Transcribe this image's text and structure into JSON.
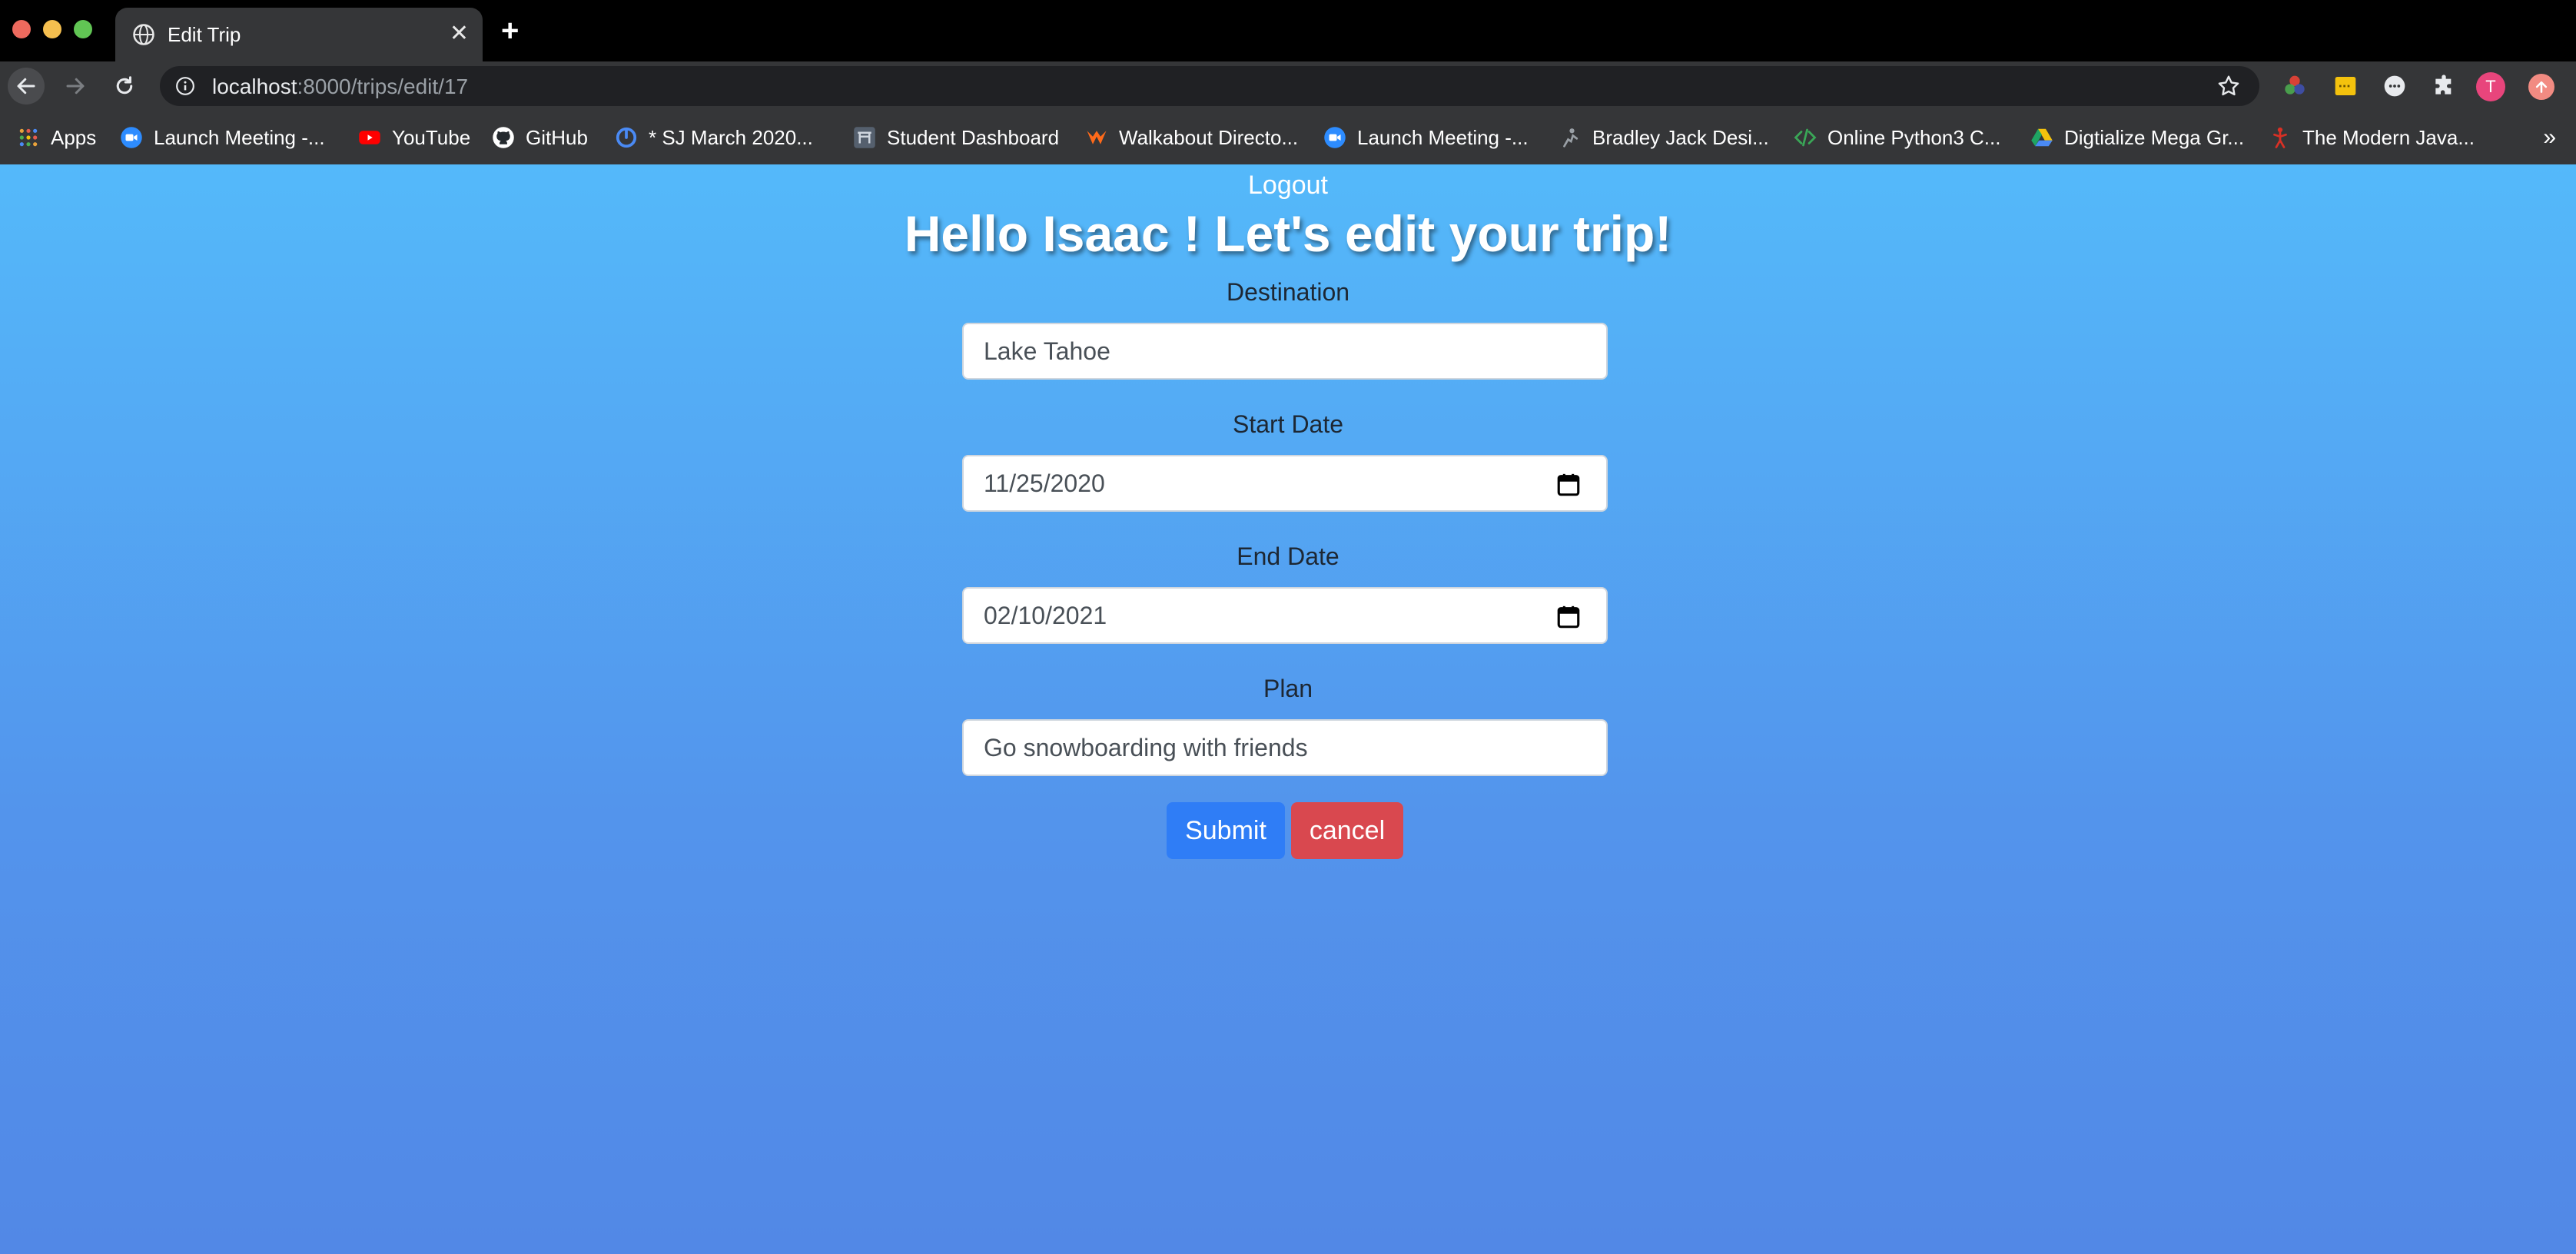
{
  "browser": {
    "tab_title": "Edit Trip",
    "url_host": "localhost",
    "url_rest": ":8000/trips/edit/17",
    "avatar_letter": "T",
    "bookmarks": [
      {
        "label": "Apps",
        "icon": "apps-grid-icon"
      },
      {
        "label": "Launch Meeting -...",
        "icon": "zoom-icon"
      },
      {
        "label": "YouTube",
        "icon": "youtube-icon"
      },
      {
        "label": "GitHub",
        "icon": "github-icon"
      },
      {
        "label": "* SJ March 2020...",
        "icon": "timer-icon"
      },
      {
        "label": "Student Dashboard",
        "icon": "gate-icon"
      },
      {
        "label": "Walkabout Directo...",
        "icon": "walkabout-icon"
      },
      {
        "label": "Launch Meeting -...",
        "icon": "zoom-icon"
      },
      {
        "label": "Bradley Jack Desi...",
        "icon": "figure-icon"
      },
      {
        "label": "Online Python3 C...",
        "icon": "code-icon"
      },
      {
        "label": "Digtialize Mega Gr...",
        "icon": "drive-icon"
      },
      {
        "label": "The Modern Java...",
        "icon": "person-icon"
      }
    ],
    "more_label": "»"
  },
  "page": {
    "logout_label": "Logout",
    "headline": "Hello Isaac ! Let's edit your trip!",
    "fields": {
      "destination": {
        "label": "Destination",
        "value": "Lake Tahoe"
      },
      "start_date": {
        "label": "Start Date",
        "value": "11/25/2020"
      },
      "end_date": {
        "label": "End Date",
        "value": "02/10/2021"
      },
      "plan": {
        "label": "Plan",
        "value": "Go snowboarding with friends"
      }
    },
    "submit_label": "Submit",
    "cancel_label": "cancel"
  },
  "colors": {
    "gradient_top": "#54b9fa",
    "gradient_bottom": "#5288e6",
    "submit": "#2f7df6",
    "cancel": "#d9484f"
  }
}
